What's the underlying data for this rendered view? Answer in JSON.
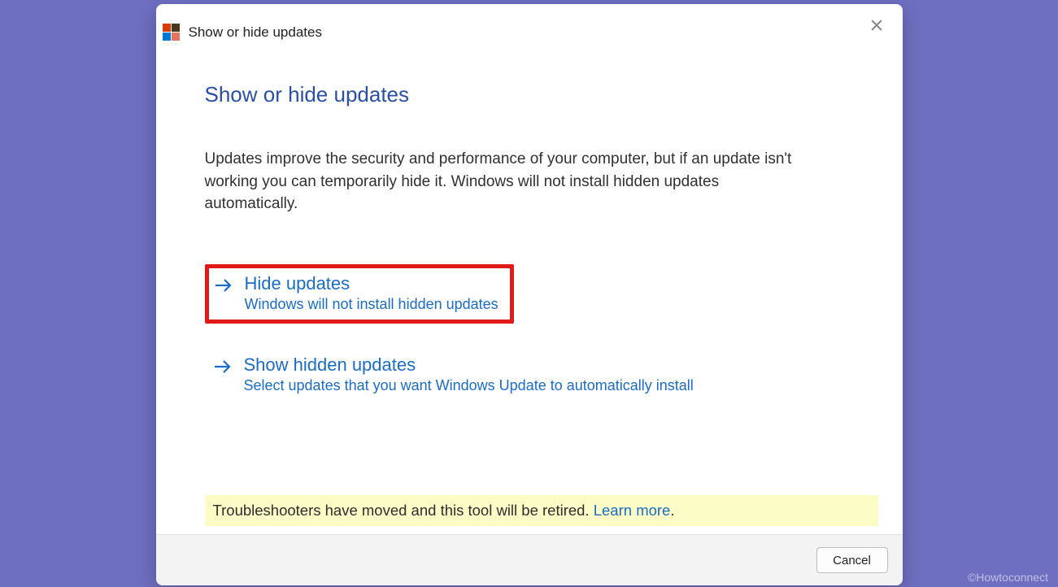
{
  "window": {
    "title": "Show or hide updates"
  },
  "page": {
    "heading": "Show or hide updates",
    "description": "Updates improve the security and performance of your computer, but if an update isn't working you can temporarily hide it. Windows will not install hidden updates automatically."
  },
  "options": {
    "hide": {
      "title": "Hide updates",
      "subtitle": "Windows will not install hidden updates"
    },
    "show": {
      "title": "Show hidden updates",
      "subtitle": "Select updates that you want Windows Update to automatically install"
    }
  },
  "notice": {
    "text": "Troubleshooters have moved and this tool will be retired. ",
    "link": "Learn more"
  },
  "footer": {
    "cancel": "Cancel"
  },
  "watermark": "©Howtoconnect"
}
